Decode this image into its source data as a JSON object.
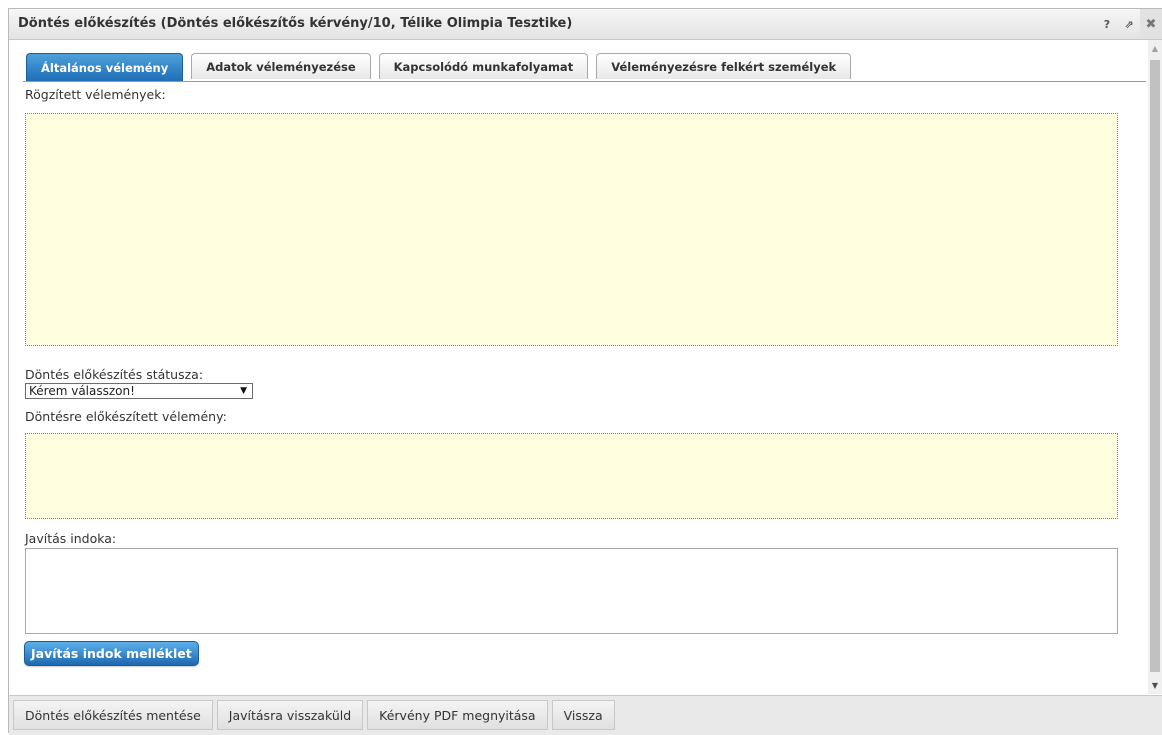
{
  "dialog": {
    "title": "Döntés előkészítés (Döntés előkészítős kérvény/10, Télike Olimpia Tesztike)",
    "help_icon": "?",
    "popout_icon": "⇗",
    "close_icon": "✖"
  },
  "tabs": [
    {
      "label": "Általános vélemény",
      "active": true
    },
    {
      "label": "Adatok véleményezése",
      "active": false
    },
    {
      "label": "Kapcsolódó munkafolyamat",
      "active": false
    },
    {
      "label": "Véleményezésre felkért személyek",
      "active": false
    }
  ],
  "form": {
    "recorded_label": "Rögzített vélemények:",
    "status_label": "Döntés előkészítés státusza:",
    "status_value": "Kérem válasszon!",
    "prepared_label": "Döntésre előkészített vélemény:",
    "reason_label": "Javítás indoka:",
    "attachment_button": "Javítás indok melléklet"
  },
  "footer": {
    "buttons": [
      "Döntés előkészítés mentése",
      "Javításra visszaküld",
      "Kérvény PDF megnyitása",
      "Vissza"
    ]
  },
  "colors": {
    "active_tab": "#2a7cc4",
    "yellow_field": "#ffffe0",
    "dotted_border": "#d86060"
  }
}
